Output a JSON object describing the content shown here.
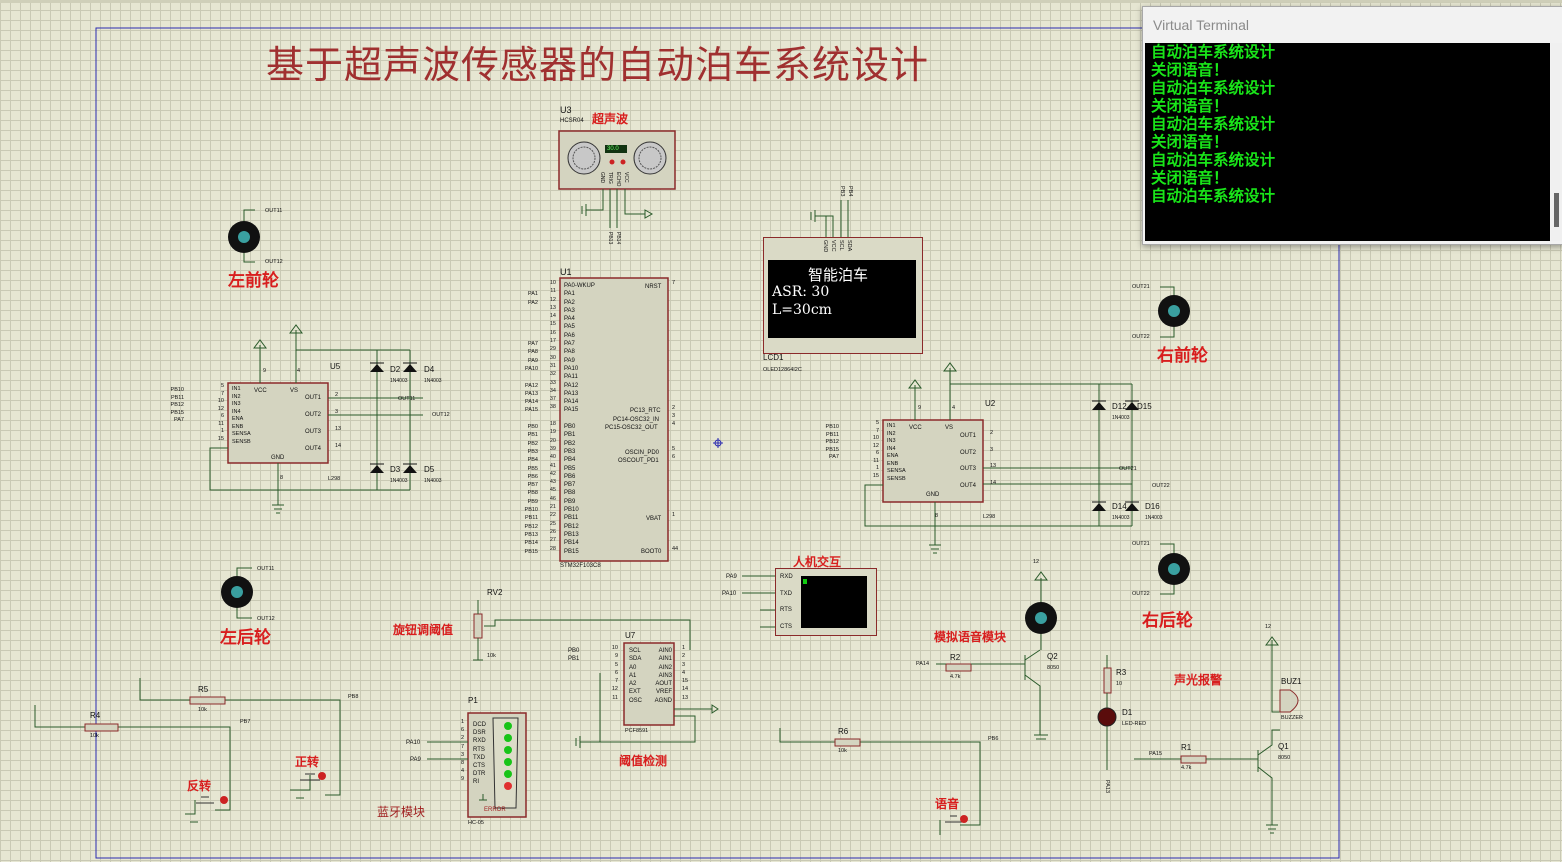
{
  "title": "基于超声波传感器的自动泊车系统设计",
  "terminal": {
    "title": "Virtual Terminal",
    "lines": [
      "自动泊车系统设计",
      "关闭语音！",
      "自动泊车系统设计",
      "关闭语音！",
      "自动泊车系统设计",
      "关闭语音！",
      "自动泊车系统设计",
      "关闭语音！",
      "自动泊车系统设计"
    ]
  },
  "oled": {
    "ref": "LCD1",
    "part": "OLED12864I2C",
    "line1": "智能泊车",
    "line2": "ASR: 30",
    "line3": "L=30cm",
    "pins": [
      "GND",
      "VCC",
      "SCL",
      "SDA"
    ],
    "nets": [
      "PB3",
      "PB4"
    ]
  },
  "labels": {
    "ultrasonic": "超声波",
    "left_front": "左前轮",
    "right_front": "右前轮",
    "left_rear": "左后轮",
    "right_rear": "右后轮",
    "hmi": "人机交互",
    "knob": "旋钮调阈值",
    "voice_module": "模拟语音模块",
    "alarm": "声光报警",
    "threshold": "阈值检测",
    "bluetooth": "蓝牙模块",
    "forward": "正转",
    "reverse": "反转",
    "voice": "语音"
  },
  "components": {
    "u3": {
      "ref": "U3",
      "part": "HCSR04",
      "display": "30.0",
      "pins": [
        "GND",
        "TRIG",
        "ECHO",
        "VCC"
      ],
      "nets": [
        "PB13",
        "PB14"
      ]
    },
    "u1": {
      "ref": "U1",
      "part": "STM32F103C8",
      "left_pins": [
        "PA0-WKUP",
        "PA1",
        "PA2",
        "PA3",
        "PA4",
        "PA5",
        "PA6",
        "PA7",
        "PA8",
        "PA9",
        "PA10",
        "PA11",
        "PA12",
        "PA13",
        "PA14",
        "PA15",
        "",
        "PB0",
        "PB1",
        "PB2",
        "PB3",
        "PB4",
        "PB5",
        "PB6",
        "PB7",
        "PB8",
        "PB9",
        "PB10",
        "PB11",
        "PB12",
        "PB13",
        "PB14",
        "PB15"
      ],
      "left_nums": [
        "10",
        "11",
        "12",
        "13",
        "14",
        "15",
        "16",
        "17",
        "29",
        "30",
        "31",
        "32",
        "33",
        "34",
        "37",
        "38",
        "",
        "18",
        "19",
        "20",
        "39",
        "40",
        "41",
        "42",
        "43",
        "45",
        "46",
        "21",
        "22",
        "25",
        "26",
        "27",
        "28"
      ],
      "left_nets": [
        "",
        "PA1",
        "PA2",
        "",
        "",
        "",
        "",
        "PA7",
        "PA8",
        "PA9",
        "PA10",
        "",
        "PA12",
        "PA13",
        "PA14",
        "PA15",
        "",
        "PB0",
        "PB1",
        "PB2",
        "PB3",
        "PB4",
        "PB5",
        "PB6",
        "PB7",
        "PB8",
        "PB9",
        "PB10",
        "PB11",
        "PB12",
        "PB13",
        "PB14",
        "PB15"
      ],
      "right_pins": [
        "NRST",
        "PC13_RTC",
        "PC14-OSC32_IN",
        "PC15-OSC32_OUT",
        "OSCIN_PD0",
        "OSCOUT_PD1",
        "VBAT",
        "BOOT0"
      ],
      "right_nums": [
        "7",
        "2",
        "3",
        "4",
        "5",
        "6",
        "1",
        "44"
      ]
    },
    "u5": {
      "ref": "U5",
      "part": "L298",
      "in_pins": [
        "IN1",
        "IN2",
        "IN3",
        "IN4",
        "ENA",
        "ENB",
        "SENSA",
        "SENSB"
      ],
      "in_nums": [
        "5",
        "7",
        "10",
        "12",
        "6",
        "11",
        "1",
        "15"
      ],
      "in_nets": [
        "PB10",
        "PB11",
        "PB12",
        "PB15",
        "PA7"
      ],
      "out_pins": [
        "OUT1",
        "OUT2",
        "OUT3",
        "OUT4"
      ],
      "out_nums": [
        "2",
        "3",
        "13",
        "14"
      ],
      "vcc": "VCC",
      "vs": "VS",
      "gnd": "GND",
      "n9": "9",
      "n4": "4",
      "n8": "8"
    },
    "u2": {
      "ref": "U2",
      "part": "L298",
      "in_pins": [
        "IN1",
        "IN2",
        "IN3",
        "IN4",
        "ENA",
        "ENB",
        "SENSA",
        "SENSB"
      ],
      "in_nums": [
        "5",
        "7",
        "10",
        "12",
        "6",
        "11",
        "1",
        "15"
      ],
      "in_nets": [
        "PB10",
        "PB11",
        "PB12",
        "PB15",
        "PA7"
      ],
      "out_pins": [
        "OUT1",
        "OUT2",
        "OUT3",
        "OUT4"
      ],
      "out_nums": [
        "2",
        "3",
        "13",
        "14"
      ],
      "vcc": "VCC",
      "vs": "VS",
      "gnd": "GND",
      "n9": "9",
      "n4": "4",
      "n8": "8"
    },
    "u7": {
      "ref": "U7",
      "part": "PCF8591",
      "left_pins": [
        "SCL",
        "SDA",
        "A0",
        "A1",
        "A2",
        "EXT",
        "OSC"
      ],
      "left_nums": [
        "10",
        "9",
        "5",
        "6",
        "7",
        "12",
        "11"
      ],
      "left_nets": [
        "PB0",
        "PB1"
      ],
      "right_pins": [
        "AIN0",
        "AIN1",
        "AIN2",
        "AIN3",
        "AOUT",
        "VREF",
        "AGND"
      ],
      "right_nums": [
        "1",
        "2",
        "3",
        "4",
        "15",
        "14",
        "13"
      ]
    },
    "p1": {
      "ref": "P1",
      "part": "HC-05",
      "pins": [
        "DCD",
        "DSR",
        "RXD",
        "RTS",
        "TXD",
        "CTS",
        "DTR",
        "RI"
      ],
      "nums": [
        "1",
        "6",
        "2",
        "7",
        "3",
        "8",
        "4",
        "9"
      ],
      "nets": [
        "PA10",
        "PA9"
      ],
      "error": "ERROR"
    },
    "vterm": {
      "pins": [
        "RXD",
        "TXD",
        "RTS",
        "CTS"
      ],
      "nets": [
        "PA9",
        "PA10"
      ]
    },
    "d2": {
      "ref": "D2",
      "part": "1N4003"
    },
    "d4": {
      "ref": "D4",
      "part": "1N4003"
    },
    "d3": {
      "ref": "D3",
      "part": "1N4003"
    },
    "d5": {
      "ref": "D5",
      "part": "1N4003"
    },
    "d12": {
      "ref": "D12",
      "part": "1N4003"
    },
    "d15": {
      "ref": "D15",
      "part": ""
    },
    "d14": {
      "ref": "D14",
      "part": "1N4003"
    },
    "d16": {
      "ref": "D16",
      "part": "1N4003"
    },
    "rv2": {
      "ref": "RV2",
      "val": "10k"
    },
    "r5": {
      "ref": "R5",
      "val": "10k",
      "net": "PB8"
    },
    "r4": {
      "ref": "R4",
      "val": "10k",
      "net": "PB7"
    },
    "r6": {
      "ref": "R6",
      "val": "10k",
      "net": "PB6"
    },
    "r2": {
      "ref": "R2",
      "val": "4.7k",
      "net": "PA14"
    },
    "r3": {
      "ref": "R3",
      "val": "10"
    },
    "r1": {
      "ref": "R1",
      "val": "4.7k",
      "net": "PA15"
    },
    "q2": {
      "ref": "Q2",
      "part": "8050",
      "v": "12"
    },
    "q1": {
      "ref": "Q1",
      "part": "8050",
      "v": "12"
    },
    "d1": {
      "ref": "D1",
      "part": "LED-RED",
      "net": "PA13"
    },
    "buz1": {
      "ref": "BUZ1",
      "part": "BUZZER"
    },
    "m_lf": {
      "a": "OUT11",
      "b": "OUT12"
    },
    "m_rf": {
      "a": "OUT21",
      "b": "OUT22"
    },
    "m_lr": {
      "a": "OUT11",
      "b": "OUT12"
    },
    "m_rr": {
      "a": "OUT21",
      "b": "OUT22"
    },
    "u5_nets": {
      "o11": "OUT11",
      "o12": "OUT12"
    },
    "u2_nets": {
      "o21": "OUT21",
      "o22": "OUT22"
    }
  }
}
